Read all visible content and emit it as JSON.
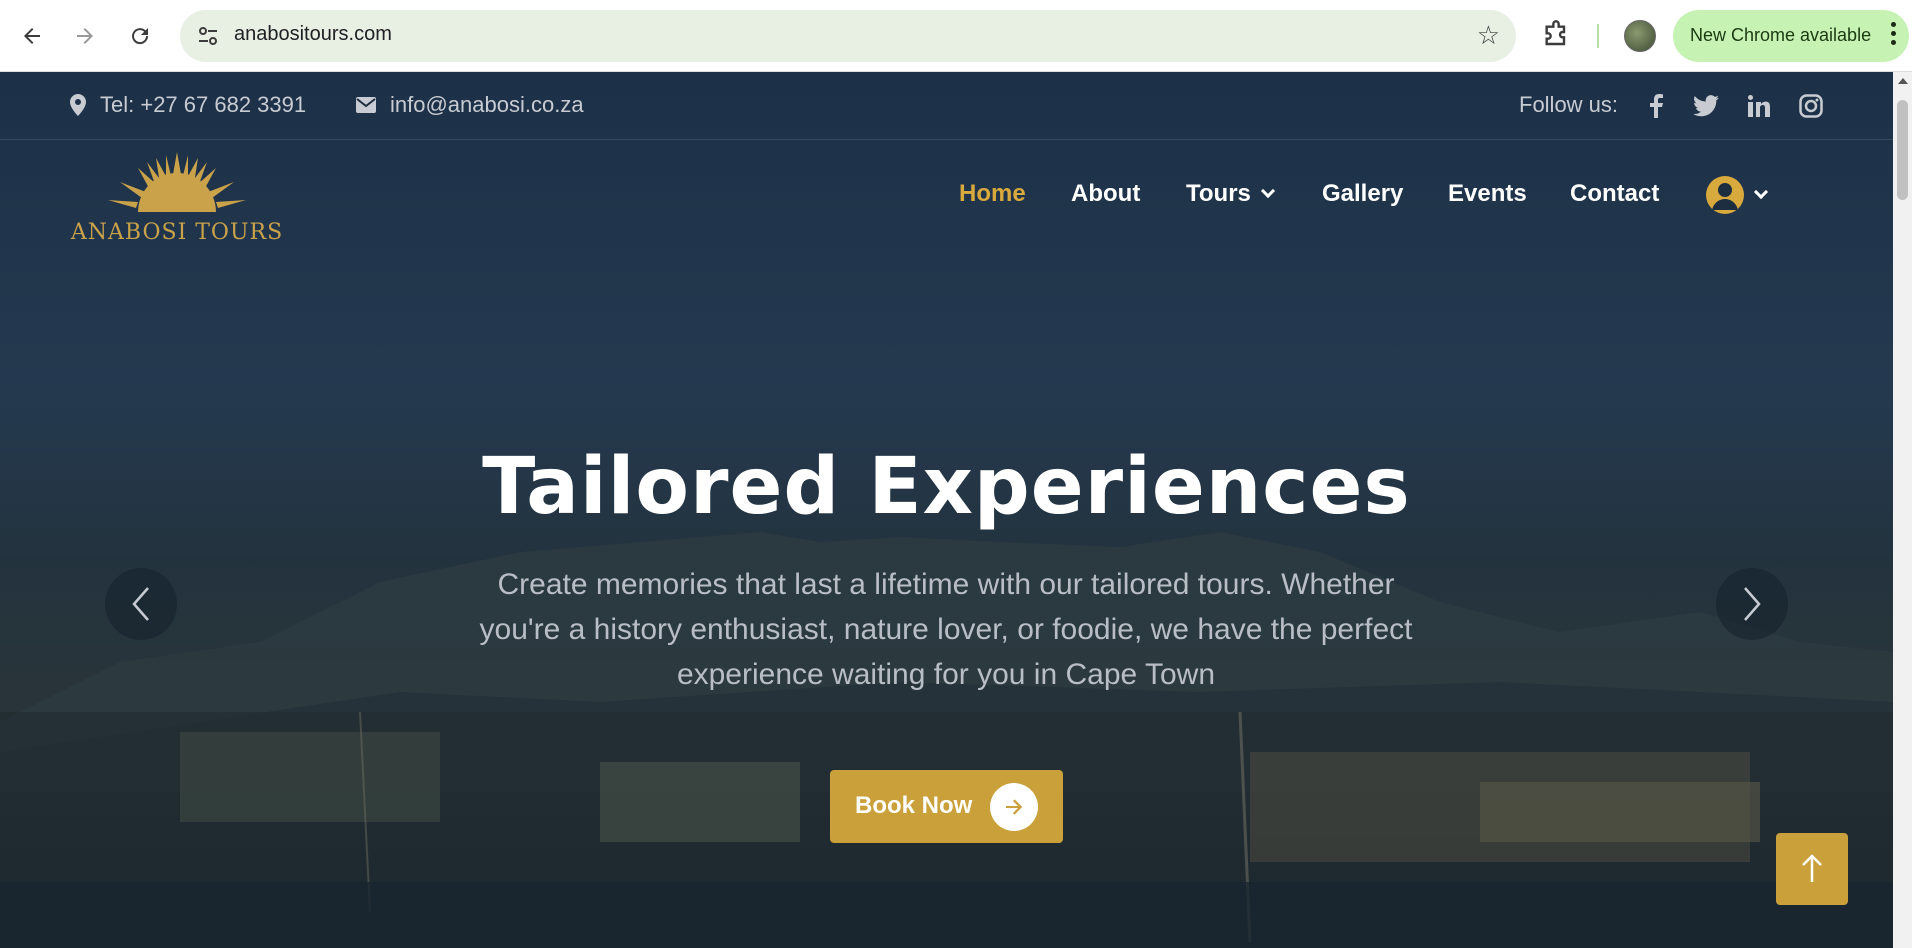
{
  "browser": {
    "url": "anabositours.com",
    "update_chip": "New Chrome available"
  },
  "topbar": {
    "phone": "Tel: +27 67 682 3391",
    "email": "info@anabosi.co.za",
    "follow_label": "Follow us:",
    "socials": [
      "facebook-icon",
      "twitter-icon",
      "linkedin-icon",
      "instagram-icon"
    ]
  },
  "logo": {
    "text": "ANABOSI TOURS"
  },
  "nav": {
    "items": [
      "Home",
      "About",
      "Tours",
      "Gallery",
      "Events",
      "Contact"
    ],
    "active": "Home"
  },
  "hero": {
    "title": "Tailored Experiences",
    "text": "Create memories that last a lifetime with our tailored tours. Whether you're a history enthusiast, nature lover, or foodie, we have the perfect experience waiting for you in Cape Town",
    "button": "Book Now"
  },
  "colors": {
    "accent": "#C9A039",
    "nav_active": "#D8A93C",
    "chip_bg": "#C6F2B4"
  }
}
